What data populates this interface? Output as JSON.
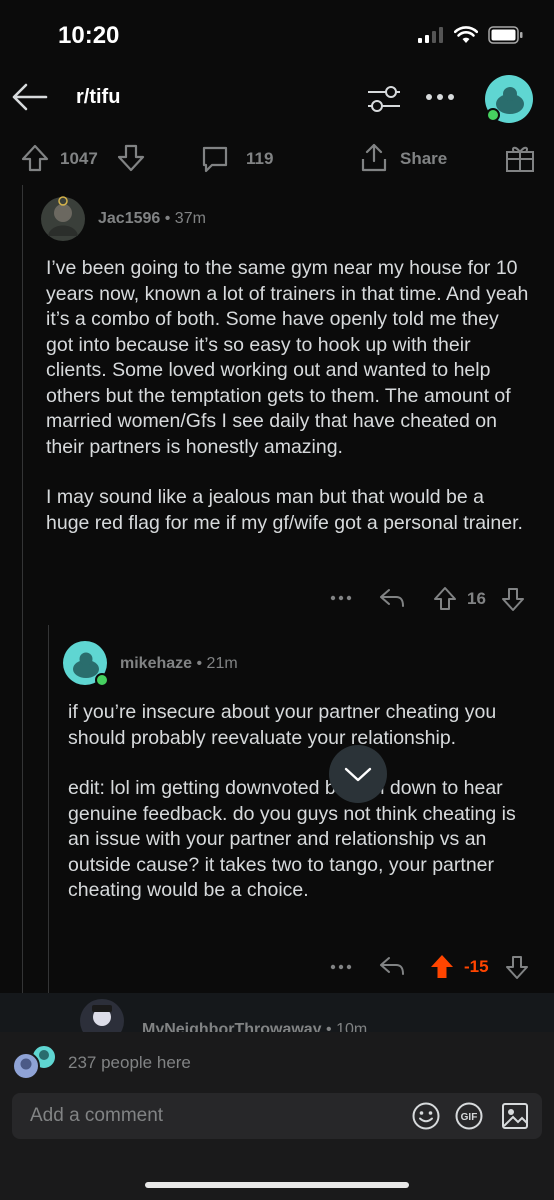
{
  "status_bar": {
    "time": "10:20"
  },
  "header": {
    "subreddit": "r/tifu"
  },
  "post_actions": {
    "upvotes": "1047",
    "comments": "119",
    "share_label": "Share"
  },
  "comments": [
    {
      "username": "Jac1596",
      "age": "37m",
      "paragraphs": [
        "I’ve been going to the same gym near my house for 10 years now, known a lot of trainers in that time. And yeah it’s a combo of both. Some have openly told me they got into because it’s so easy to hook up with their clients. Some loved working out and wanted to help others but the temptation gets to them. The amount of married women/Gfs I see daily that have cheated on their partners is honestly amazing.",
        "I may sound like a jealous man but that would be a huge red flag for me if my gf/wife got a personal trainer."
      ],
      "score": "16"
    },
    {
      "username": "mikehaze",
      "age": "21m",
      "paragraphs": [
        "if you’re insecure about your partner cheating you should probably reevaluate your relationship.",
        "edit: lol im getting downvoted but am down to hear genuine feedback. do you guys not think cheating is an issue with your partner and relationship vs an outside cause? it takes two to tango, your partner cheating would be a choice."
      ],
      "score": "-15"
    },
    {
      "username": "MyNeighborThrowaway",
      "age": "10m"
    }
  ],
  "presence": {
    "text": "237 people here"
  },
  "comment_input": {
    "placeholder": "Add a comment"
  },
  "colors": {
    "upvoted": "#ff4500",
    "muted": "#818384",
    "avatar_teal": "#5fd6d2",
    "online": "#46d160"
  },
  "icons": [
    "back-arrow-icon",
    "filter-icon",
    "more-icon",
    "upvote-icon",
    "downvote-icon",
    "comment-icon",
    "share-icon",
    "award-icon",
    "reply-icon",
    "chevron-down-icon",
    "emoji-icon",
    "gif-icon",
    "image-icon"
  ]
}
